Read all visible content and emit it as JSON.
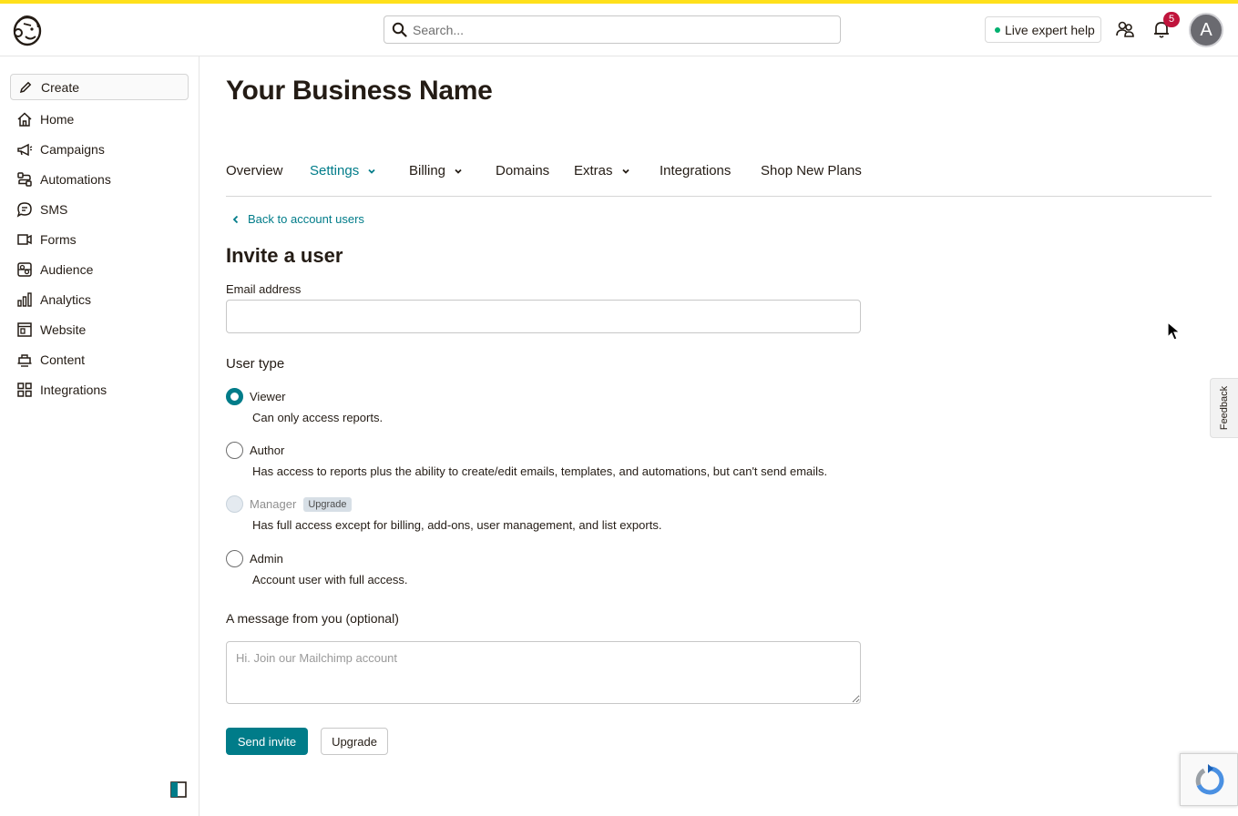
{
  "header": {
    "search_placeholder": "Search...",
    "live_help_label": "Live expert help",
    "notification_count": "5",
    "avatar_initial": "A"
  },
  "sidebar": {
    "create_label": "Create",
    "items": [
      {
        "label": "Home",
        "icon": "home-icon"
      },
      {
        "label": "Campaigns",
        "icon": "megaphone-icon"
      },
      {
        "label": "Automations",
        "icon": "automations-icon"
      },
      {
        "label": "SMS",
        "icon": "sms-icon"
      },
      {
        "label": "Forms",
        "icon": "forms-icon"
      },
      {
        "label": "Audience",
        "icon": "audience-icon"
      },
      {
        "label": "Analytics",
        "icon": "analytics-icon"
      },
      {
        "label": "Website",
        "icon": "website-icon"
      },
      {
        "label": "Content",
        "icon": "content-icon"
      },
      {
        "label": "Integrations",
        "icon": "integrations-icon"
      }
    ]
  },
  "page": {
    "title": "Your Business Name",
    "tabs": [
      {
        "label": "Overview",
        "dropdown": false,
        "active": false
      },
      {
        "label": "Settings",
        "dropdown": true,
        "active": true
      },
      {
        "label": "Billing",
        "dropdown": true,
        "active": false
      },
      {
        "label": "Domains",
        "dropdown": false,
        "active": false
      },
      {
        "label": "Extras",
        "dropdown": true,
        "active": false
      },
      {
        "label": "Integrations",
        "dropdown": false,
        "active": false
      },
      {
        "label": "Shop New Plans",
        "dropdown": false,
        "active": false
      }
    ],
    "back_link": "Back to account users"
  },
  "form": {
    "title": "Invite a user",
    "email_label": "Email address",
    "email_value": "",
    "user_type_label": "User type",
    "user_types": [
      {
        "label": "Viewer",
        "description": "Can only access reports.",
        "selected": true,
        "disabled": false,
        "badge": ""
      },
      {
        "label": "Author",
        "description": "Has access to reports plus the ability to create/edit emails, templates, and automations, but can't send emails.",
        "selected": false,
        "disabled": false,
        "badge": ""
      },
      {
        "label": "Manager",
        "description": "Has full access except for billing, add-ons, user management, and list exports.",
        "selected": false,
        "disabled": true,
        "badge": "Upgrade"
      },
      {
        "label": "Admin",
        "description": "Account user with full access.",
        "selected": false,
        "disabled": false,
        "badge": ""
      }
    ],
    "message_label": "A message from you (optional)",
    "message_placeholder": "Hi. Join our Mailchimp account",
    "send_label": "Send invite",
    "upgrade_label": "Upgrade"
  },
  "feedback_label": "Feedback",
  "colors": {
    "accent": "#007c89",
    "brand_yellow": "#ffe01b",
    "badge_red": "#c0143c"
  }
}
